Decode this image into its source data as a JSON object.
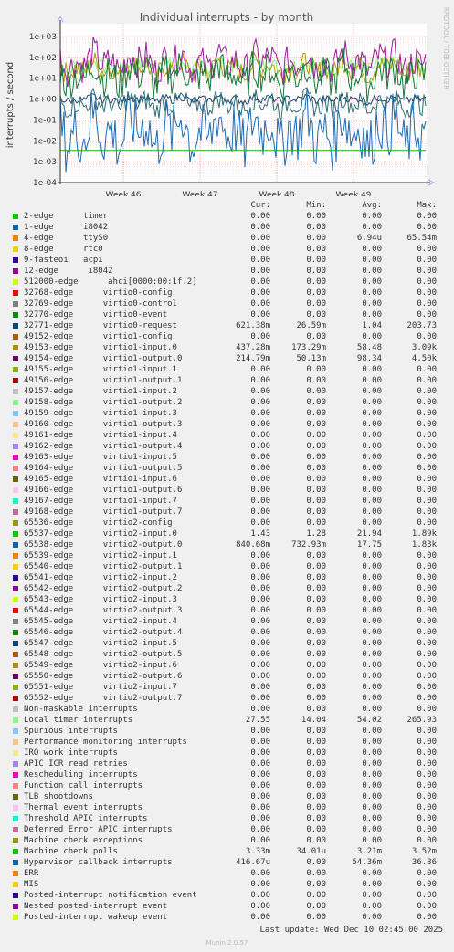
{
  "chart_data": {
    "type": "line",
    "title": "Individual interrupts - by month",
    "ylabel": "interrupts / second",
    "yscale": "log",
    "ylim": [
      0.0001,
      1000
    ],
    "yticks": [
      "1e+03",
      "1e+02",
      "1e+01",
      "1e+00",
      "1e-01",
      "1e-02",
      "1e-03",
      "1e-04"
    ],
    "xticks": [
      "Week 46",
      "Week 47",
      "Week 48",
      "Week 49"
    ],
    "side_label": "RRDTOOL / TOBI OETIKER",
    "series_traced": [
      {
        "name": "Local timer interrupts",
        "color": "#7bfc73",
        "base": 40,
        "spread": 0.35
      },
      {
        "name": "virtio1-input.0",
        "color": "#b0990e",
        "base": 30,
        "spread": 0.55
      },
      {
        "name": "virtio1-output.0",
        "color": "#9e1c9c",
        "base": 60,
        "spread": 0.8
      },
      {
        "name": "virtio2-input.0",
        "color": "#107a39",
        "base": 15,
        "spread": 0.9
      },
      {
        "name": "virtio2-output.0",
        "color": "#124878",
        "base": 1,
        "spread": 0.2
      },
      {
        "name": "virtio0-request",
        "color": "#2c6e74",
        "base": 0.6,
        "spread": 0.5
      },
      {
        "name": "Hypervisor callback interrupts",
        "color": "#1c6ab5",
        "base": 0.03,
        "spread": 1.4
      },
      {
        "name": "Machine check polls",
        "color": "#23a623",
        "base": 0.0035,
        "spread": 0.0
      }
    ]
  },
  "legend": {
    "headers": [
      "Cur:",
      "Min:",
      "Avg:",
      "Max:"
    ],
    "rows": [
      {
        "label": "2-edge      timer",
        "color": "#00cc00",
        "cur": "0.00",
        "min": "0.00",
        "avg": "0.00",
        "max": "0.00"
      },
      {
        "label": "1-edge      i8042",
        "color": "#0066b3",
        "cur": "0.00",
        "min": "0.00",
        "avg": "0.00",
        "max": "0.00"
      },
      {
        "label": "4-edge      ttyS0",
        "color": "#ff8000",
        "cur": "0.00",
        "min": "0.00",
        "avg": "6.94u",
        "max": "65.54m"
      },
      {
        "label": "8-edge      rtc0",
        "color": "#ffcc00",
        "cur": "0.00",
        "min": "0.00",
        "avg": "0.00",
        "max": "0.00"
      },
      {
        "label": "9-fasteoi   acpi",
        "color": "#330099",
        "cur": "0.00",
        "min": "0.00",
        "avg": "0.00",
        "max": "0.00"
      },
      {
        "label": "12-edge      i8042",
        "color": "#990099",
        "cur": "0.00",
        "min": "0.00",
        "avg": "0.00",
        "max": "0.00"
      },
      {
        "label": "512000-edge      ahci[0000:00:1f.2]",
        "color": "#ccff00",
        "cur": "0.00",
        "min": "0.00",
        "avg": "0.00",
        "max": "0.00"
      },
      {
        "label": "32768-edge      virtio0-config",
        "color": "#ff0000",
        "cur": "0.00",
        "min": "0.00",
        "avg": "0.00",
        "max": "0.00"
      },
      {
        "label": "32769-edge      virtio0-control",
        "color": "#808080",
        "cur": "0.00",
        "min": "0.00",
        "avg": "0.00",
        "max": "0.00"
      },
      {
        "label": "32770-edge      virtio0-event",
        "color": "#008f00",
        "cur": "0.00",
        "min": "0.00",
        "avg": "0.00",
        "max": "0.00"
      },
      {
        "label": "32771-edge      virtio0-request",
        "color": "#00487d",
        "cur": "621.38m",
        "min": "26.59m",
        "avg": "1.04",
        "max": "203.73"
      },
      {
        "label": "49152-edge      virtio1-config",
        "color": "#b35a00",
        "cur": "0.00",
        "min": "0.00",
        "avg": "0.00",
        "max": "0.00"
      },
      {
        "label": "49153-edge      virtio1-input.0",
        "color": "#b38f00",
        "cur": "437.28m",
        "min": "173.29m",
        "avg": "58.48",
        "max": "3.09k"
      },
      {
        "label": "49154-edge      virtio1-output.0",
        "color": "#6b006b",
        "cur": "214.79m",
        "min": "50.13m",
        "avg": "98.34",
        "max": "4.50k"
      },
      {
        "label": "49155-edge      virtio1-input.1",
        "color": "#8fb300",
        "cur": "0.00",
        "min": "0.00",
        "avg": "0.00",
        "max": "0.00"
      },
      {
        "label": "49156-edge      virtio1-output.1",
        "color": "#b30000",
        "cur": "0.00",
        "min": "0.00",
        "avg": "0.00",
        "max": "0.00"
      },
      {
        "label": "49157-edge      virtio1-input.2",
        "color": "#bebebe",
        "cur": "0.00",
        "min": "0.00",
        "avg": "0.00",
        "max": "0.00"
      },
      {
        "label": "49158-edge      virtio1-output.2",
        "color": "#80ff80",
        "cur": "0.00",
        "min": "0.00",
        "avg": "0.00",
        "max": "0.00"
      },
      {
        "label": "49159-edge      virtio1-input.3",
        "color": "#80c9ff",
        "cur": "0.00",
        "min": "0.00",
        "avg": "0.00",
        "max": "0.00"
      },
      {
        "label": "49160-edge      virtio1-output.3",
        "color": "#ffc080",
        "cur": "0.00",
        "min": "0.00",
        "avg": "0.00",
        "max": "0.00"
      },
      {
        "label": "49161-edge      virtio1-input.4",
        "color": "#ffe680",
        "cur": "0.00",
        "min": "0.00",
        "avg": "0.00",
        "max": "0.00"
      },
      {
        "label": "49162-edge      virtio1-output.4",
        "color": "#aa80ff",
        "cur": "0.00",
        "min": "0.00",
        "avg": "0.00",
        "max": "0.00"
      },
      {
        "label": "49163-edge      virtio1-input.5",
        "color": "#ee00cc",
        "cur": "0.00",
        "min": "0.00",
        "avg": "0.00",
        "max": "0.00"
      },
      {
        "label": "49164-edge      virtio1-output.5",
        "color": "#ff8080",
        "cur": "0.00",
        "min": "0.00",
        "avg": "0.00",
        "max": "0.00"
      },
      {
        "label": "49165-edge      virtio1-input.6",
        "color": "#666600",
        "cur": "0.00",
        "min": "0.00",
        "avg": "0.00",
        "max": "0.00"
      },
      {
        "label": "49166-edge      virtio1-output.6",
        "color": "#ffbfff",
        "cur": "0.00",
        "min": "0.00",
        "avg": "0.00",
        "max": "0.00"
      },
      {
        "label": "49167-edge      virtio1-input.7",
        "color": "#00ffcc",
        "cur": "0.00",
        "min": "0.00",
        "avg": "0.00",
        "max": "0.00"
      },
      {
        "label": "49168-edge      virtio1-output.7",
        "color": "#cc6699",
        "cur": "0.00",
        "min": "0.00",
        "avg": "0.00",
        "max": "0.00"
      },
      {
        "label": "65536-edge      virtio2-config",
        "color": "#999900",
        "cur": "0.00",
        "min": "0.00",
        "avg": "0.00",
        "max": "0.00"
      },
      {
        "label": "65537-edge      virtio2-input.0",
        "color": "#00cc00",
        "cur": "1.43",
        "min": "1.28",
        "avg": "21.94",
        "max": "1.89k"
      },
      {
        "label": "65538-edge      virtio2-output.0",
        "color": "#0066b3",
        "cur": "840.68m",
        "min": "732.93m",
        "avg": "17.75",
        "max": "1.83k"
      },
      {
        "label": "65539-edge      virtio2-input.1",
        "color": "#ff8000",
        "cur": "0.00",
        "min": "0.00",
        "avg": "0.00",
        "max": "0.00"
      },
      {
        "label": "65540-edge      virtio2-output.1",
        "color": "#ffcc00",
        "cur": "0.00",
        "min": "0.00",
        "avg": "0.00",
        "max": "0.00"
      },
      {
        "label": "65541-edge      virtio2-input.2",
        "color": "#330099",
        "cur": "0.00",
        "min": "0.00",
        "avg": "0.00",
        "max": "0.00"
      },
      {
        "label": "65542-edge      virtio2-output.2",
        "color": "#990099",
        "cur": "0.00",
        "min": "0.00",
        "avg": "0.00",
        "max": "0.00"
      },
      {
        "label": "65543-edge      virtio2-input.3",
        "color": "#ccff00",
        "cur": "0.00",
        "min": "0.00",
        "avg": "0.00",
        "max": "0.00"
      },
      {
        "label": "65544-edge      virtio2-output.3",
        "color": "#ff0000",
        "cur": "0.00",
        "min": "0.00",
        "avg": "0.00",
        "max": "0.00"
      },
      {
        "label": "65545-edge      virtio2-input.4",
        "color": "#808080",
        "cur": "0.00",
        "min": "0.00",
        "avg": "0.00",
        "max": "0.00"
      },
      {
        "label": "65546-edge      virtio2-output.4",
        "color": "#008f00",
        "cur": "0.00",
        "min": "0.00",
        "avg": "0.00",
        "max": "0.00"
      },
      {
        "label": "65547-edge      virtio2-input.5",
        "color": "#00487d",
        "cur": "0.00",
        "min": "0.00",
        "avg": "0.00",
        "max": "0.00"
      },
      {
        "label": "65548-edge      virtio2-output.5",
        "color": "#b35a00",
        "cur": "0.00",
        "min": "0.00",
        "avg": "0.00",
        "max": "0.00"
      },
      {
        "label": "65549-edge      virtio2-input.6",
        "color": "#b38f00",
        "cur": "0.00",
        "min": "0.00",
        "avg": "0.00",
        "max": "0.00"
      },
      {
        "label": "65550-edge      virtio2-output.6",
        "color": "#6b006b",
        "cur": "0.00",
        "min": "0.00",
        "avg": "0.00",
        "max": "0.00"
      },
      {
        "label": "65551-edge      virtio2-input.7",
        "color": "#8fb300",
        "cur": "0.00",
        "min": "0.00",
        "avg": "0.00",
        "max": "0.00"
      },
      {
        "label": "65552-edge      virtio2-output.7",
        "color": "#b30000",
        "cur": "0.00",
        "min": "0.00",
        "avg": "0.00",
        "max": "0.00"
      },
      {
        "label": "Non-maskable interrupts",
        "color": "#bebebe",
        "cur": "0.00",
        "min": "0.00",
        "avg": "0.00",
        "max": "0.00"
      },
      {
        "label": "Local timer interrupts",
        "color": "#80ff80",
        "cur": "27.55",
        "min": "14.04",
        "avg": "54.02",
        "max": "265.93"
      },
      {
        "label": "Spurious interrupts",
        "color": "#80c9ff",
        "cur": "0.00",
        "min": "0.00",
        "avg": "0.00",
        "max": "0.00"
      },
      {
        "label": "Performance monitoring interrupts",
        "color": "#ffc080",
        "cur": "0.00",
        "min": "0.00",
        "avg": "0.00",
        "max": "0.00"
      },
      {
        "label": "IRQ work interrupts",
        "color": "#ffe680",
        "cur": "0.00",
        "min": "0.00",
        "avg": "0.00",
        "max": "0.00"
      },
      {
        "label": "APIC ICR read retries",
        "color": "#aa80ff",
        "cur": "0.00",
        "min": "0.00",
        "avg": "0.00",
        "max": "0.00"
      },
      {
        "label": "Rescheduling interrupts",
        "color": "#ee00cc",
        "cur": "0.00",
        "min": "0.00",
        "avg": "0.00",
        "max": "0.00"
      },
      {
        "label": "Function call interrupts",
        "color": "#ff8080",
        "cur": "0.00",
        "min": "0.00",
        "avg": "0.00",
        "max": "0.00"
      },
      {
        "label": "TLB shootdowns",
        "color": "#666600",
        "cur": "0.00",
        "min": "0.00",
        "avg": "0.00",
        "max": "0.00"
      },
      {
        "label": "Thermal event interrupts",
        "color": "#ffbfff",
        "cur": "0.00",
        "min": "0.00",
        "avg": "0.00",
        "max": "0.00"
      },
      {
        "label": "Threshold APIC interrupts",
        "color": "#00ffcc",
        "cur": "0.00",
        "min": "0.00",
        "avg": "0.00",
        "max": "0.00"
      },
      {
        "label": "Deferred Error APIC interrupts",
        "color": "#cc6699",
        "cur": "0.00",
        "min": "0.00",
        "avg": "0.00",
        "max": "0.00"
      },
      {
        "label": "Machine check exceptions",
        "color": "#999900",
        "cur": "0.00",
        "min": "0.00",
        "avg": "0.00",
        "max": "0.00"
      },
      {
        "label": "Machine check polls",
        "color": "#00cc00",
        "cur": "3.33m",
        "min": "34.01u",
        "avg": "3.21m",
        "max": "3.52m"
      },
      {
        "label": "Hypervisor callback interrupts",
        "color": "#0066b3",
        "cur": "416.67u",
        "min": "0.00",
        "avg": "54.36m",
        "max": "36.86"
      },
      {
        "label": "ERR",
        "color": "#ff8000",
        "cur": "0.00",
        "min": "0.00",
        "avg": "0.00",
        "max": "0.00"
      },
      {
        "label": "MIS",
        "color": "#ffcc00",
        "cur": "0.00",
        "min": "0.00",
        "avg": "0.00",
        "max": "0.00"
      },
      {
        "label": "Posted-interrupt notification event",
        "color": "#330099",
        "cur": "0.00",
        "min": "0.00",
        "avg": "0.00",
        "max": "0.00"
      },
      {
        "label": "Nested posted-interrupt event",
        "color": "#990099",
        "cur": "0.00",
        "min": "0.00",
        "avg": "0.00",
        "max": "0.00"
      },
      {
        "label": "Posted-interrupt wakeup event",
        "color": "#ccff00",
        "cur": "0.00",
        "min": "0.00",
        "avg": "0.00",
        "max": "0.00"
      }
    ]
  },
  "footer": {
    "last_update": "Last update: Wed Dec 10 02:45:00 2025",
    "version": "Munin 2.0.57"
  }
}
